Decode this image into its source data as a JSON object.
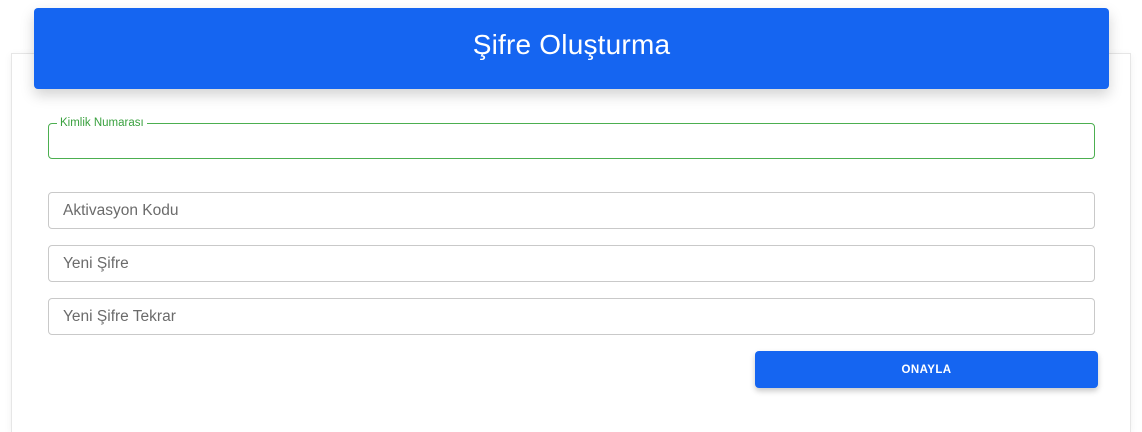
{
  "header": {
    "title": "Şifre Oluşturma"
  },
  "form": {
    "kimlik": {
      "label": "Kimlik Numarası",
      "value": ""
    },
    "aktivasyon": {
      "placeholder": "Aktivasyon Kodu",
      "value": ""
    },
    "yeni_sifre": {
      "placeholder": "Yeni Şifre",
      "value": ""
    },
    "yeni_sifre_tekrar": {
      "placeholder": "Yeni Şifre Tekrar",
      "value": ""
    },
    "submit_label": "ONAYLA"
  },
  "colors": {
    "primary": "#1565f1",
    "focus_border": "#4caf50",
    "field_border": "#c9c9c9"
  }
}
